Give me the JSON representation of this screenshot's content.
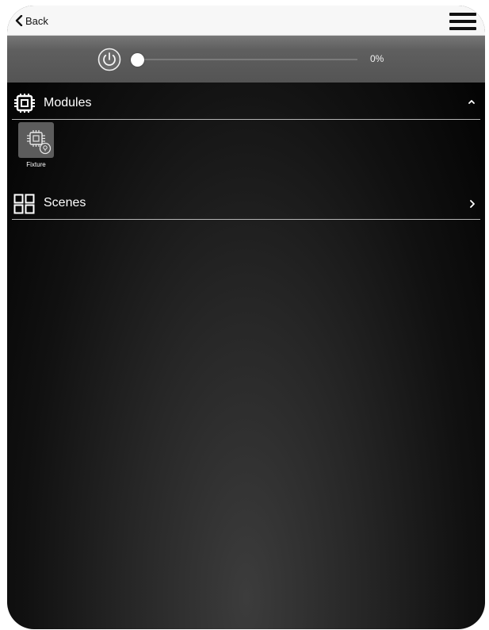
{
  "nav": {
    "back_label": "Back"
  },
  "control": {
    "level_percent": 0,
    "level_text": "0%"
  },
  "modules": {
    "label": "Modules",
    "items": [
      {
        "label": "Fixture"
      }
    ]
  },
  "scenes": {
    "label": "Scenes"
  },
  "icons": {
    "back": "chevron-left-icon",
    "menu": "hamburger-menu-icon",
    "power": "power-icon",
    "modules": "chip-icon",
    "scenes": "grid-icon"
  },
  "colors": {
    "background": "#000000",
    "topbar": "#f7f7f7",
    "controlbar": "#5f5f5f",
    "text": "#ffffff"
  }
}
